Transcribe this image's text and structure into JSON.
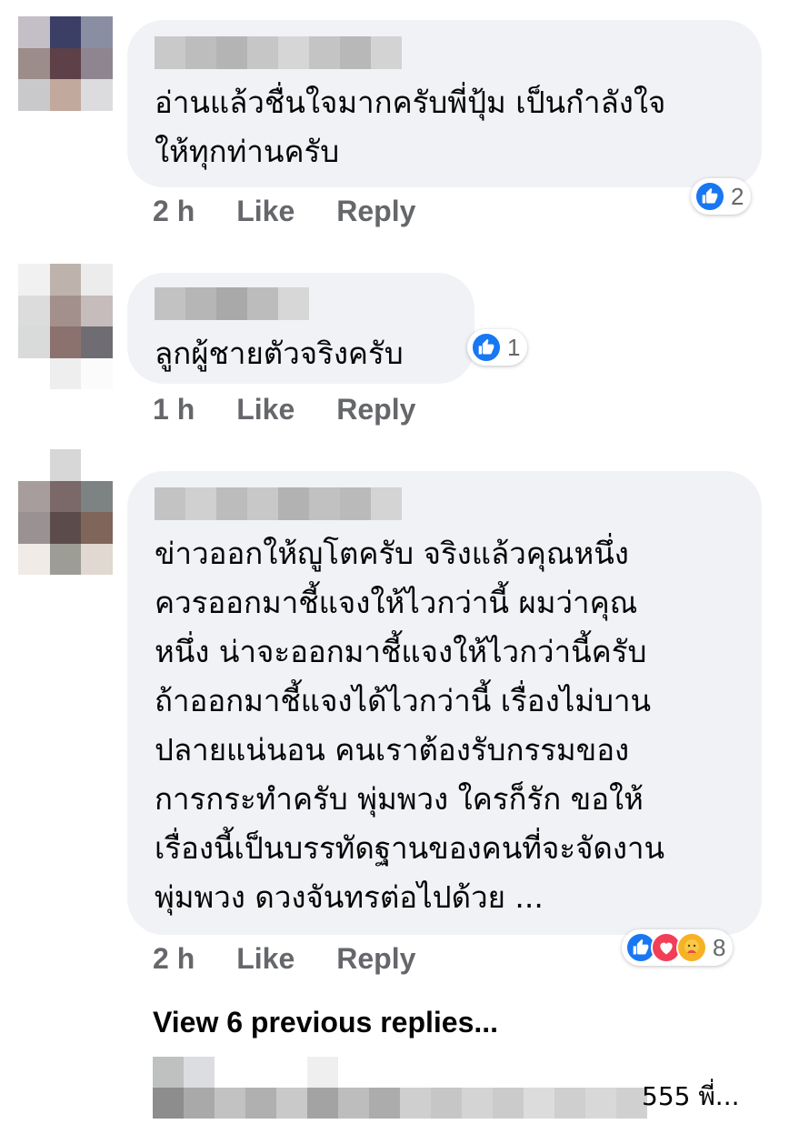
{
  "comments": [
    {
      "text": "อ่านแล้วชื่นใจมากครับพี่ปุ้ม เป็นกำลังใจ\nให้ทุกท่านครับ",
      "time": "2 h",
      "like_label": "Like",
      "reply_label": "Reply",
      "reaction_count": "2"
    },
    {
      "text": "ลูกผู้ชายตัวจริงครับ",
      "time": "1 h",
      "like_label": "Like",
      "reply_label": "Reply",
      "reaction_count": "1"
    },
    {
      "text": "ข่าวออกให้ญูโตครับ จริงแล้วคุณหนึ่ง\nควรออกมาชี้แจงให้ไวกว่านี้ ผมว่าคุณ\nหนึ่ง น่าจะออกมาชี้แจงให้ไวกว่านี้ครับ\nถ้าออกมาชี้แจงได้ไวกว่านี้ เรื่องไม่บาน\nปลายแน่นอน คนเราต้องรับกรรมของ\nการกระทำครับ พุ่มพวง ใครก็รัก ขอให้\nเรื่องนี้เป็นบรรทัดฐานของคนที่จะจัดงาน\nพุ่มพวง ดวงจันทรต่อไปด้วย ...",
      "time": "2 h",
      "like_label": "Like",
      "reply_label": "Reply",
      "reaction_count": "8"
    }
  ],
  "view_previous_replies": "View 6 previous replies...",
  "reply_preview_text": "555 พี่...",
  "colors": {
    "bubble": "#f0f2f5",
    "meta_text": "#65676b",
    "like_blue": "#1877f2",
    "love_red": "#f33e58",
    "care_yellow": "#f7b125"
  },
  "icons": [
    "like-reaction-icon",
    "love-reaction-icon",
    "care-reaction-icon"
  ]
}
